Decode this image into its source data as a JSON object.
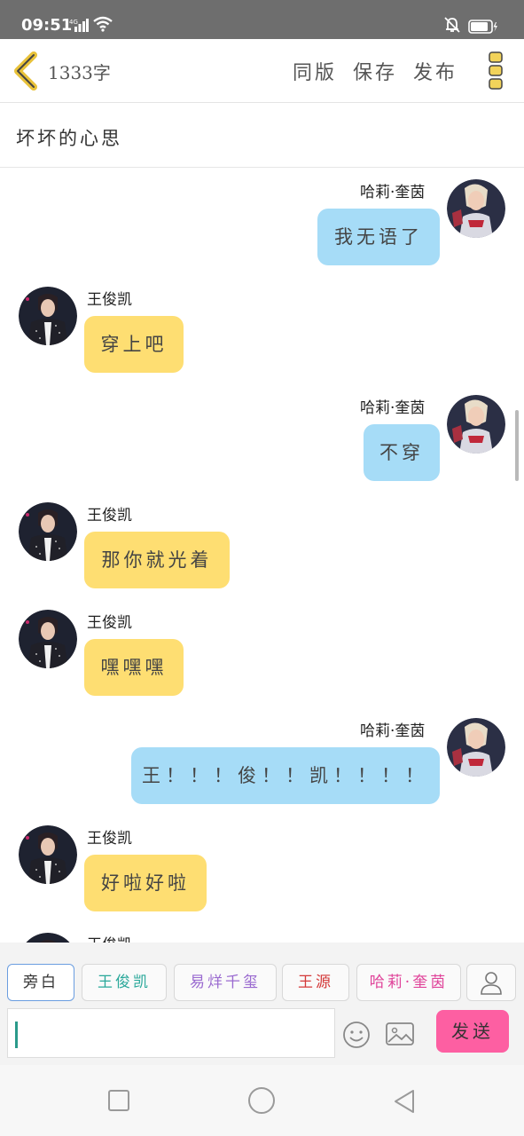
{
  "status_bar": {
    "time": "09:51",
    "network": "4G"
  },
  "header": {
    "word_count": "1333字",
    "buttons": [
      "同版",
      "保存",
      "发布"
    ]
  },
  "title": "坏坏的心思",
  "messages": [
    {
      "side": "right",
      "name": "哈莉·奎茵",
      "text": "我无语了",
      "color": "blue"
    },
    {
      "side": "left",
      "name": "王俊凯",
      "text": "穿上吧",
      "color": "yellow"
    },
    {
      "side": "right",
      "name": "哈莉·奎茵",
      "text": "不穿",
      "color": "blue"
    },
    {
      "side": "left",
      "name": "王俊凯",
      "text": "那你就光着",
      "color": "yellow"
    },
    {
      "side": "left",
      "name": "王俊凯",
      "text": "嘿嘿嘿",
      "color": "yellow"
    },
    {
      "side": "right",
      "name": "哈莉·奎茵",
      "text": "王！！！俊！！凯！！！！",
      "color": "blue"
    },
    {
      "side": "left",
      "name": "王俊凯",
      "text": "好啦好啦",
      "color": "yellow"
    },
    {
      "side": "left",
      "name": "王俊凯",
      "text": "",
      "color": "yellow"
    }
  ],
  "characters": [
    {
      "label": "旁白",
      "color": "#333333",
      "selected": true
    },
    {
      "label": "王俊凯",
      "color": "#2aa89a",
      "selected": false
    },
    {
      "label": "易烊千玺",
      "color": "#9a6ad0",
      "selected": false
    },
    {
      "label": "王源",
      "color": "#d43a3a",
      "selected": false
    },
    {
      "label": "哈莉·奎茵",
      "color": "#e0449a",
      "selected": false
    }
  ],
  "composer": {
    "input_value": "",
    "send_label": "发送"
  },
  "colors": {
    "blue_bubble": "#a6dcf7",
    "yellow_bubble": "#fede72",
    "send": "#fd5fa2"
  }
}
